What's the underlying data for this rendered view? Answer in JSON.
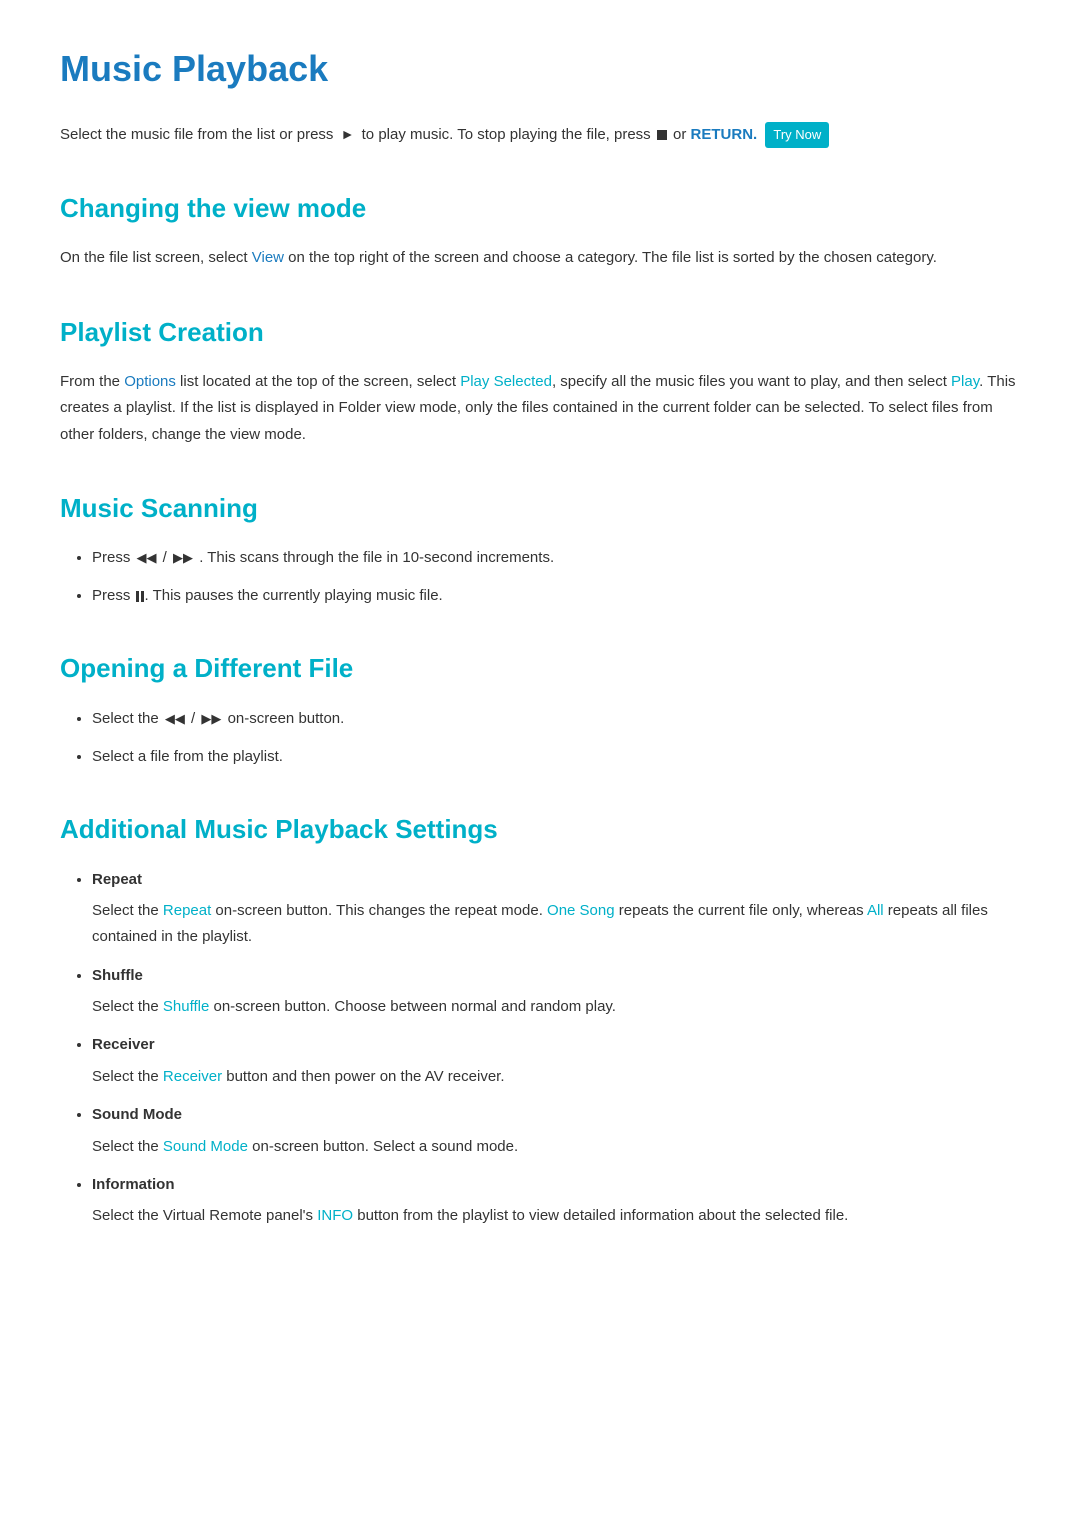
{
  "page": {
    "title": "Music Playback",
    "intro": {
      "text_before": "Select the music file from the list or press",
      "play_label": "►",
      "text_middle": "to play music. To stop playing the file, press",
      "stop_label": "■",
      "text_or": "or",
      "return_label": "RETURN.",
      "try_now_label": "Try Now"
    },
    "sections": [
      {
        "id": "changing-view-mode",
        "title": "Changing the view mode",
        "content": "On the file list screen, select View on the top right of the screen and choose a category. The file list is sorted by the chosen category.",
        "view_keyword": "View"
      },
      {
        "id": "playlist-creation",
        "title": "Playlist Creation",
        "content_before": "From the",
        "options_keyword": "Options",
        "content_middle": "list located at the top of the screen, select",
        "play_selected_keyword": "Play Selected",
        "content_after": ", specify all the music files you want to play, and then select",
        "play_keyword": "Play",
        "content_end": ". This creates a playlist. If the list is displayed in Folder view mode, only the files contained in the current folder can be selected. To select files from other folders, change the view mode."
      },
      {
        "id": "music-scanning",
        "title": "Music Scanning",
        "items": [
          {
            "text_before": "Press",
            "icon": "skip",
            "text_after": "/    . This scans through the file in 10-second increments."
          },
          {
            "text_before": "Press",
            "icon": "pause",
            "text_after": ". This pauses the currently playing music file."
          }
        ]
      },
      {
        "id": "opening-different-file",
        "title": "Opening a Different File",
        "items": [
          {
            "text": "Select the    /    on-screen button."
          },
          {
            "text": "Select a file from the playlist."
          }
        ]
      },
      {
        "id": "additional-settings",
        "title": "Additional Music Playback Settings",
        "items": [
          {
            "label": "Repeat",
            "desc_before": "Select the",
            "keyword": "Repeat",
            "desc_middle": "on-screen button. This changes the repeat mode.",
            "keyword2": "One Song",
            "desc_middle2": "repeats the current file only, whereas",
            "keyword3": "All",
            "desc_end": "repeats all files contained in the playlist."
          },
          {
            "label": "Shuffle",
            "desc_before": "Select the",
            "keyword": "Shuffle",
            "desc_end": "on-screen button. Choose between normal and random play."
          },
          {
            "label": "Receiver",
            "desc_before": "Select the",
            "keyword": "Receiver",
            "desc_end": "button and then power on the AV receiver."
          },
          {
            "label": "Sound Mode",
            "desc_before": "Select the",
            "keyword": "Sound Mode",
            "desc_end": "on-screen button. Select a sound mode."
          },
          {
            "label": "Information",
            "desc_before": "Select the Virtual Remote panel's",
            "keyword": "INFO",
            "desc_end": "button from the playlist to view detailed information about the selected file."
          }
        ]
      }
    ]
  }
}
